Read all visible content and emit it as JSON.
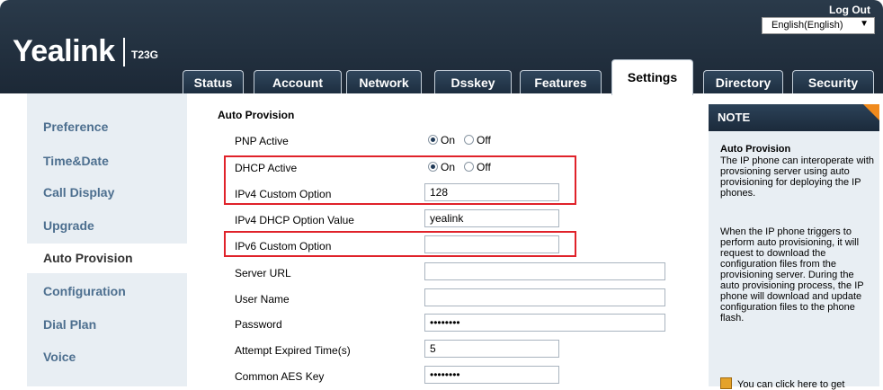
{
  "header": {
    "logo": "Yealink",
    "model": "T23G",
    "logout": "Log Out",
    "language": "English(English)"
  },
  "tabs": [
    "Status",
    "Account",
    "Network",
    "Dsskey",
    "Features",
    "Settings",
    "Directory",
    "Security"
  ],
  "active_tab": "Settings",
  "sidebar": {
    "items": [
      "Preference",
      "Time&Date",
      "Call Display",
      "Upgrade",
      "Auto Provision",
      "Configuration",
      "Dial Plan",
      "Voice"
    ],
    "active": "Auto Provision"
  },
  "form": {
    "section_title": "Auto Provision",
    "pnp_active": {
      "label": "PNP Active",
      "on": "On",
      "off": "Off",
      "value": "On"
    },
    "dhcp_active": {
      "label": "DHCP Active",
      "on": "On",
      "off": "Off",
      "value": "On"
    },
    "ipv4_custom_option": {
      "label": "IPv4 Custom Option",
      "value": "128"
    },
    "ipv4_dhcp_option_value": {
      "label": "IPv4 DHCP Option Value",
      "value": "yealink"
    },
    "ipv6_custom_option": {
      "label": "IPv6 Custom Option",
      "value": ""
    },
    "server_url": {
      "label": "Server URL",
      "value": ""
    },
    "user_name": {
      "label": "User Name",
      "value": ""
    },
    "password": {
      "label": "Password",
      "value": "••••••••"
    },
    "attempt_expired_time": {
      "label": "Attempt Expired Time(s)",
      "value": "5"
    },
    "common_aes_key": {
      "label": "Common AES Key",
      "value": "••••••••"
    }
  },
  "note": {
    "header": "NOTE",
    "title": "Auto Provision",
    "para1": "The IP phone can interoperate with provsioning server using auto provisioning for deploying the IP phones.",
    "para2": "When the IP phone triggers to perform auto provisioning, it will request to download the configuration files from the provisioning server. During the auto provisioning process, the IP phone will download and update configuration files to the phone flash.",
    "link": "You can click here to get"
  },
  "colors": {
    "highlight": "#e0222a",
    "nav_text": "#4d6f8f",
    "header_bg": "#1c2836"
  }
}
